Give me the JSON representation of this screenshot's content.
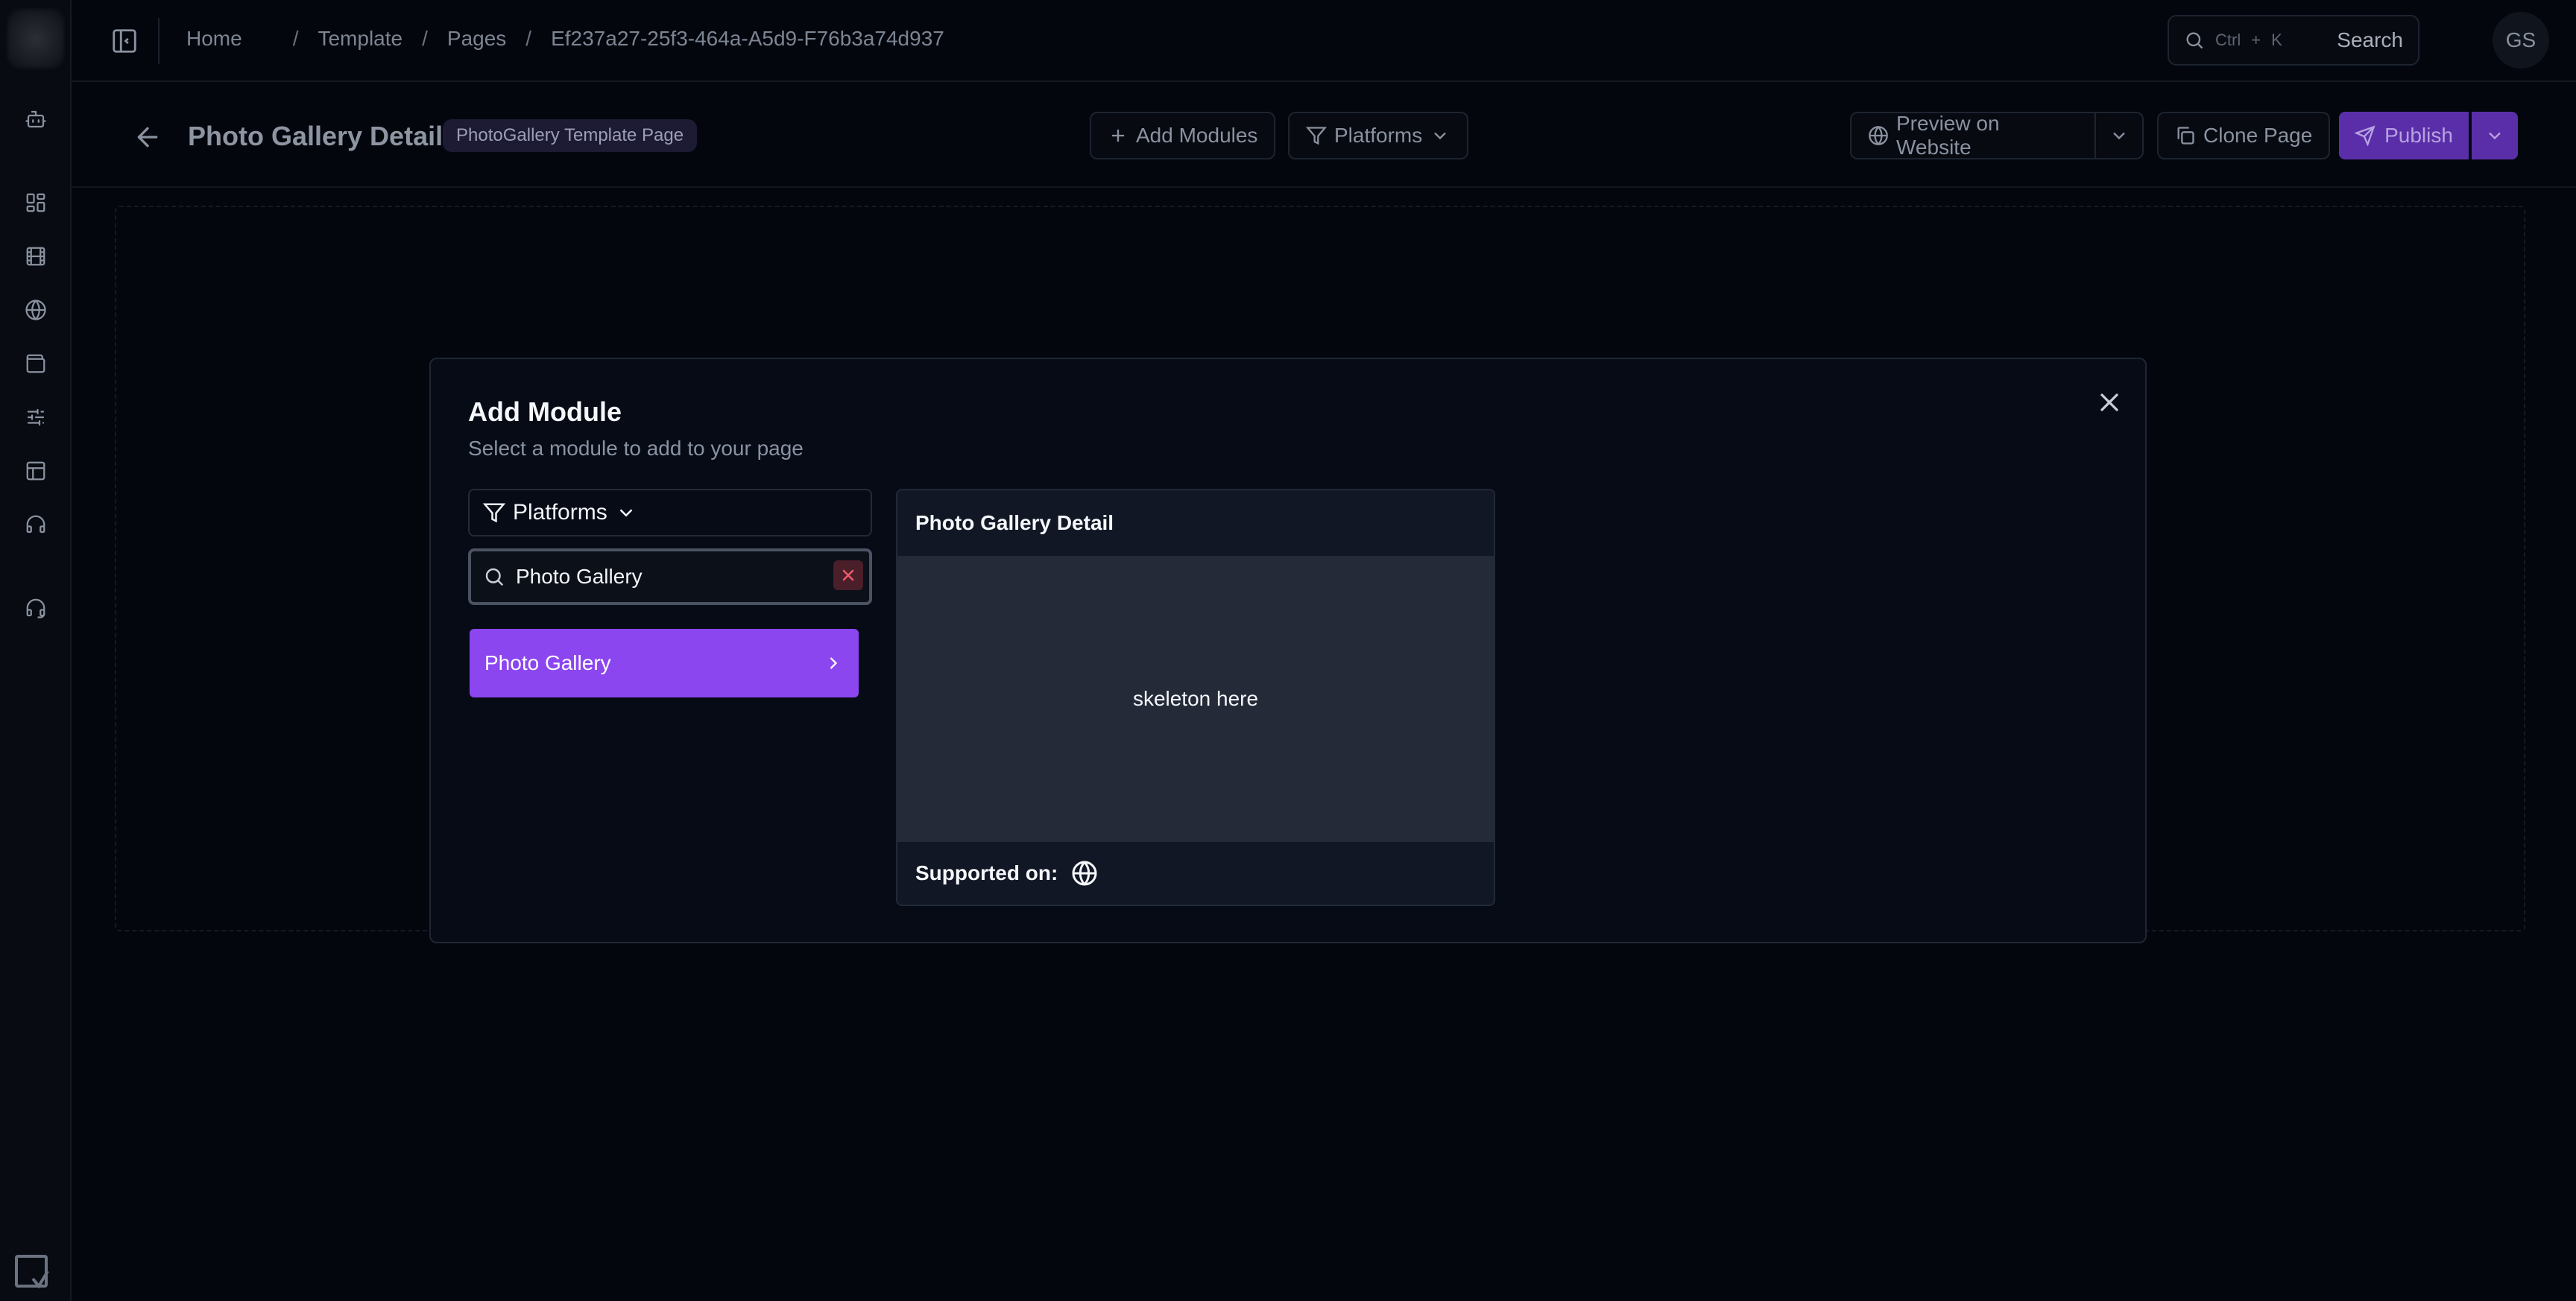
{
  "sidebar": {
    "icons": [
      "robot-icon",
      "dashboard-icon",
      "film-icon",
      "globe-icon",
      "wallet-icon",
      "sliders-icon",
      "layout-icon",
      "headphones-icon",
      "support-icon"
    ]
  },
  "topbar": {
    "breadcrumb": [
      "Home",
      "Template",
      "Pages",
      "Ef237a27-25f3-464a-A5d9-F76b3a74d937"
    ],
    "breadcrumb_sep": "/",
    "search": {
      "shortcut_ctrl": "Ctrl",
      "shortcut_plus": "+",
      "shortcut_k": "K",
      "label": "Search"
    },
    "avatar_initials": "GS"
  },
  "page_header": {
    "title": "Photo Gallery Detail",
    "template_badge": "PhotoGallery Template Page",
    "add_modules_label": "Add Modules",
    "platforms_label": "Platforms",
    "preview_label": "Preview on Website",
    "clone_label": "Clone Page",
    "publish_label": "Publish"
  },
  "modal": {
    "title": "Add Module",
    "subtitle": "Select a module to add to your page",
    "platforms_label": "Platforms",
    "search_value": "Photo Gallery",
    "results": [
      "Photo Gallery"
    ],
    "preview": {
      "title": "Photo Gallery Detail",
      "body_text": "skeleton here",
      "supported_label": "Supported on:"
    }
  },
  "colors": {
    "accent": "#8b46f0",
    "publish": "#5a2ea8",
    "background": "#04060d",
    "modal_bg": "#070b16"
  }
}
